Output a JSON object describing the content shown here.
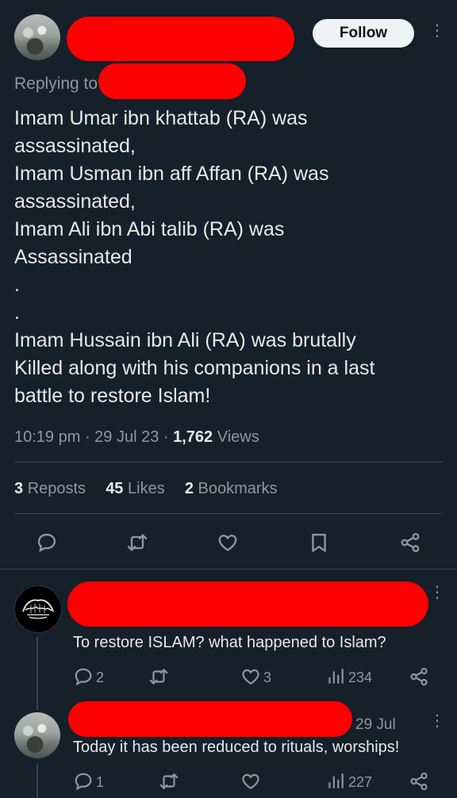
{
  "main_tweet": {
    "follow_label": "Follow",
    "replying_label": "Replying to",
    "text_lines": [
      "Imam Umar ibn khattab (RA) was",
      "assassinated,",
      "Imam Usman ibn aff Affan (RA) was",
      "assassinated,",
      "Imam Ali ibn Abi talib (RA) was",
      "Assassinated",
      ".",
      ".",
      "Imam Hussain ibn Ali (RA) was brutally",
      "Killed along with his companions in a last",
      "battle to restore Islam!"
    ],
    "time": "10:19 pm",
    "date": "29 Jul 23",
    "views_count": "1,762",
    "views_label": "Views",
    "reposts_count": "3",
    "reposts_label": "Reposts",
    "likes_count": "45",
    "likes_label": "Likes",
    "bookmarks_count": "2",
    "bookmarks_label": "Bookmarks"
  },
  "replies": [
    {
      "text": "To restore ISLAM? what happened to Islam?",
      "date": "",
      "reply_count": "2",
      "repost_count": "",
      "like_count": "3",
      "view_count": "234"
    },
    {
      "text": "Today it has been reduced to rituals, worships!",
      "date": "29 Jul",
      "reply_count": "1",
      "repost_count": "",
      "like_count": "",
      "view_count": "227"
    }
  ],
  "icons": [
    "kebab-menu-icon",
    "reply-icon",
    "repost-icon",
    "like-icon",
    "bookmark-icon",
    "share-icon",
    "views-icon"
  ],
  "colors": {
    "background": "#15202b",
    "text": "#e7e9ea",
    "muted": "#8b98a5",
    "divider": "#38444d",
    "redaction": "#ff0000"
  }
}
